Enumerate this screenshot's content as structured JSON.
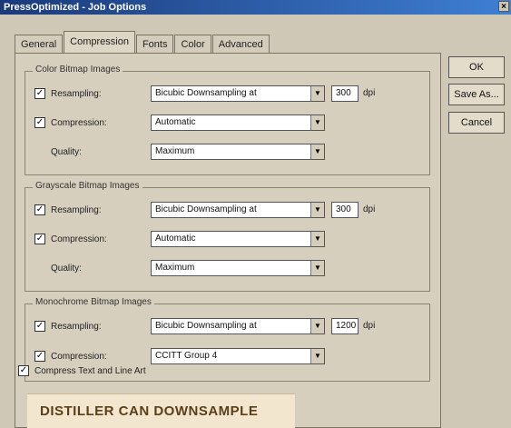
{
  "window": {
    "title": "PressOptimized - Job Options",
    "close_label": "×"
  },
  "tabs": [
    {
      "label": "General"
    },
    {
      "label": "Compression"
    },
    {
      "label": "Fonts"
    },
    {
      "label": "Color"
    },
    {
      "label": "Advanced"
    }
  ],
  "groups": {
    "color": {
      "title": "Color Bitmap Images",
      "resampling": {
        "label": "Resampling:",
        "value": "Bicubic Downsampling at",
        "dpi": "300",
        "checked": "✓"
      },
      "compression": {
        "label": "Compression:",
        "value": "Automatic",
        "checked": "✓"
      },
      "quality": {
        "label": "Quality:",
        "value": "Maximum"
      }
    },
    "grayscale": {
      "title": "Grayscale Bitmap Images",
      "resampling": {
        "label": "Resampling:",
        "value": "Bicubic Downsampling at",
        "dpi": "300",
        "checked": "✓"
      },
      "compression": {
        "label": "Compression:",
        "value": "Automatic",
        "checked": "✓"
      },
      "quality": {
        "label": "Quality:",
        "value": "Maximum"
      }
    },
    "mono": {
      "title": "Monochrome Bitmap Images",
      "resampling": {
        "label": "Resampling:",
        "value": "Bicubic Downsampling at",
        "dpi": "1200",
        "checked": "✓"
      },
      "compression": {
        "label": "Compression:",
        "value": "CCITT Group 4",
        "checked": "✓"
      }
    }
  },
  "dpi_unit": "dpi",
  "compress_text": {
    "label": "Compress Text and Line Art",
    "checked": "✓"
  },
  "buttons": {
    "ok": "OK",
    "save_as": "Save As...",
    "cancel": "Cancel"
  },
  "caption": "DISTILLER CAN DOWNSAMPLE IMAGES"
}
